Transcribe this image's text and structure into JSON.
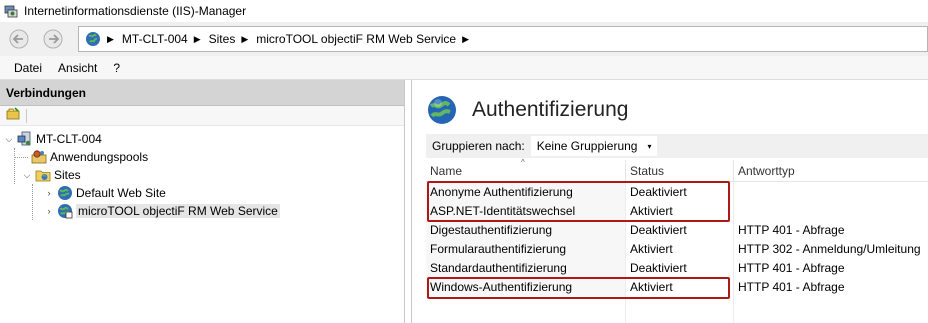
{
  "window": {
    "title": "Internetinformationsdienste (IIS)-Manager",
    "title_icon": "iis-manager-icon"
  },
  "navigation": {
    "back_icon": "back-arrow-icon",
    "forward_icon": "forward-arrow-icon",
    "breadcrumbs": [
      "MT-CLT-004",
      "Sites",
      "microTOOL objectiF RM Web Service"
    ],
    "separator": "▶"
  },
  "menu": [
    "Datei",
    "Ansicht",
    "?"
  ],
  "connections": {
    "header": "Verbindungen",
    "tree": [
      {
        "label": "MT-CLT-004",
        "icon": "server-icon",
        "expander": "⌵"
      },
      {
        "label": "Anwendungspools",
        "icon": "app-pools-icon",
        "expander": ""
      },
      {
        "label": "Sites",
        "icon": "sites-folder-icon",
        "expander": "⌵"
      },
      {
        "label": "Default Web Site",
        "icon": "globe-icon",
        "expander": "›"
      },
      {
        "label": "microTOOL objectiF RM Web Service",
        "icon": "globe-icon",
        "expander": "›",
        "selected": true
      }
    ]
  },
  "feature": {
    "title": "Authentifizierung",
    "icon": "globe-lock-icon",
    "group_by_label": "Gruppieren nach:",
    "group_by_value": "Keine Gruppierung",
    "group_caret": "▾",
    "sort_indicator": "^",
    "columns": [
      "Name",
      "Status",
      "Antworttyp"
    ],
    "rows": [
      {
        "name": "Anonyme Authentifizierung",
        "status": "Deaktiviert",
        "response": ""
      },
      {
        "name": "ASP.NET-Identitätswechsel",
        "status": "Aktiviert",
        "response": ""
      },
      {
        "name": "Digestauthentifizierung",
        "status": "Deaktiviert",
        "response": "HTTP 401 - Abfrage"
      },
      {
        "name": "Formularauthentifizierung",
        "status": "Aktiviert",
        "response": "HTTP 302 - Anmeldung/Umleitung"
      },
      {
        "name": "Standardauthentifizierung",
        "status": "Deaktiviert",
        "response": "HTTP 401 - Abfrage"
      },
      {
        "name": "Windows-Authentifizierung",
        "status": "Aktiviert",
        "response": "HTTP 401 - Abfrage"
      }
    ]
  },
  "colors": {
    "highlight_box": "#b01818",
    "selected_row": "#e5e5e5"
  }
}
